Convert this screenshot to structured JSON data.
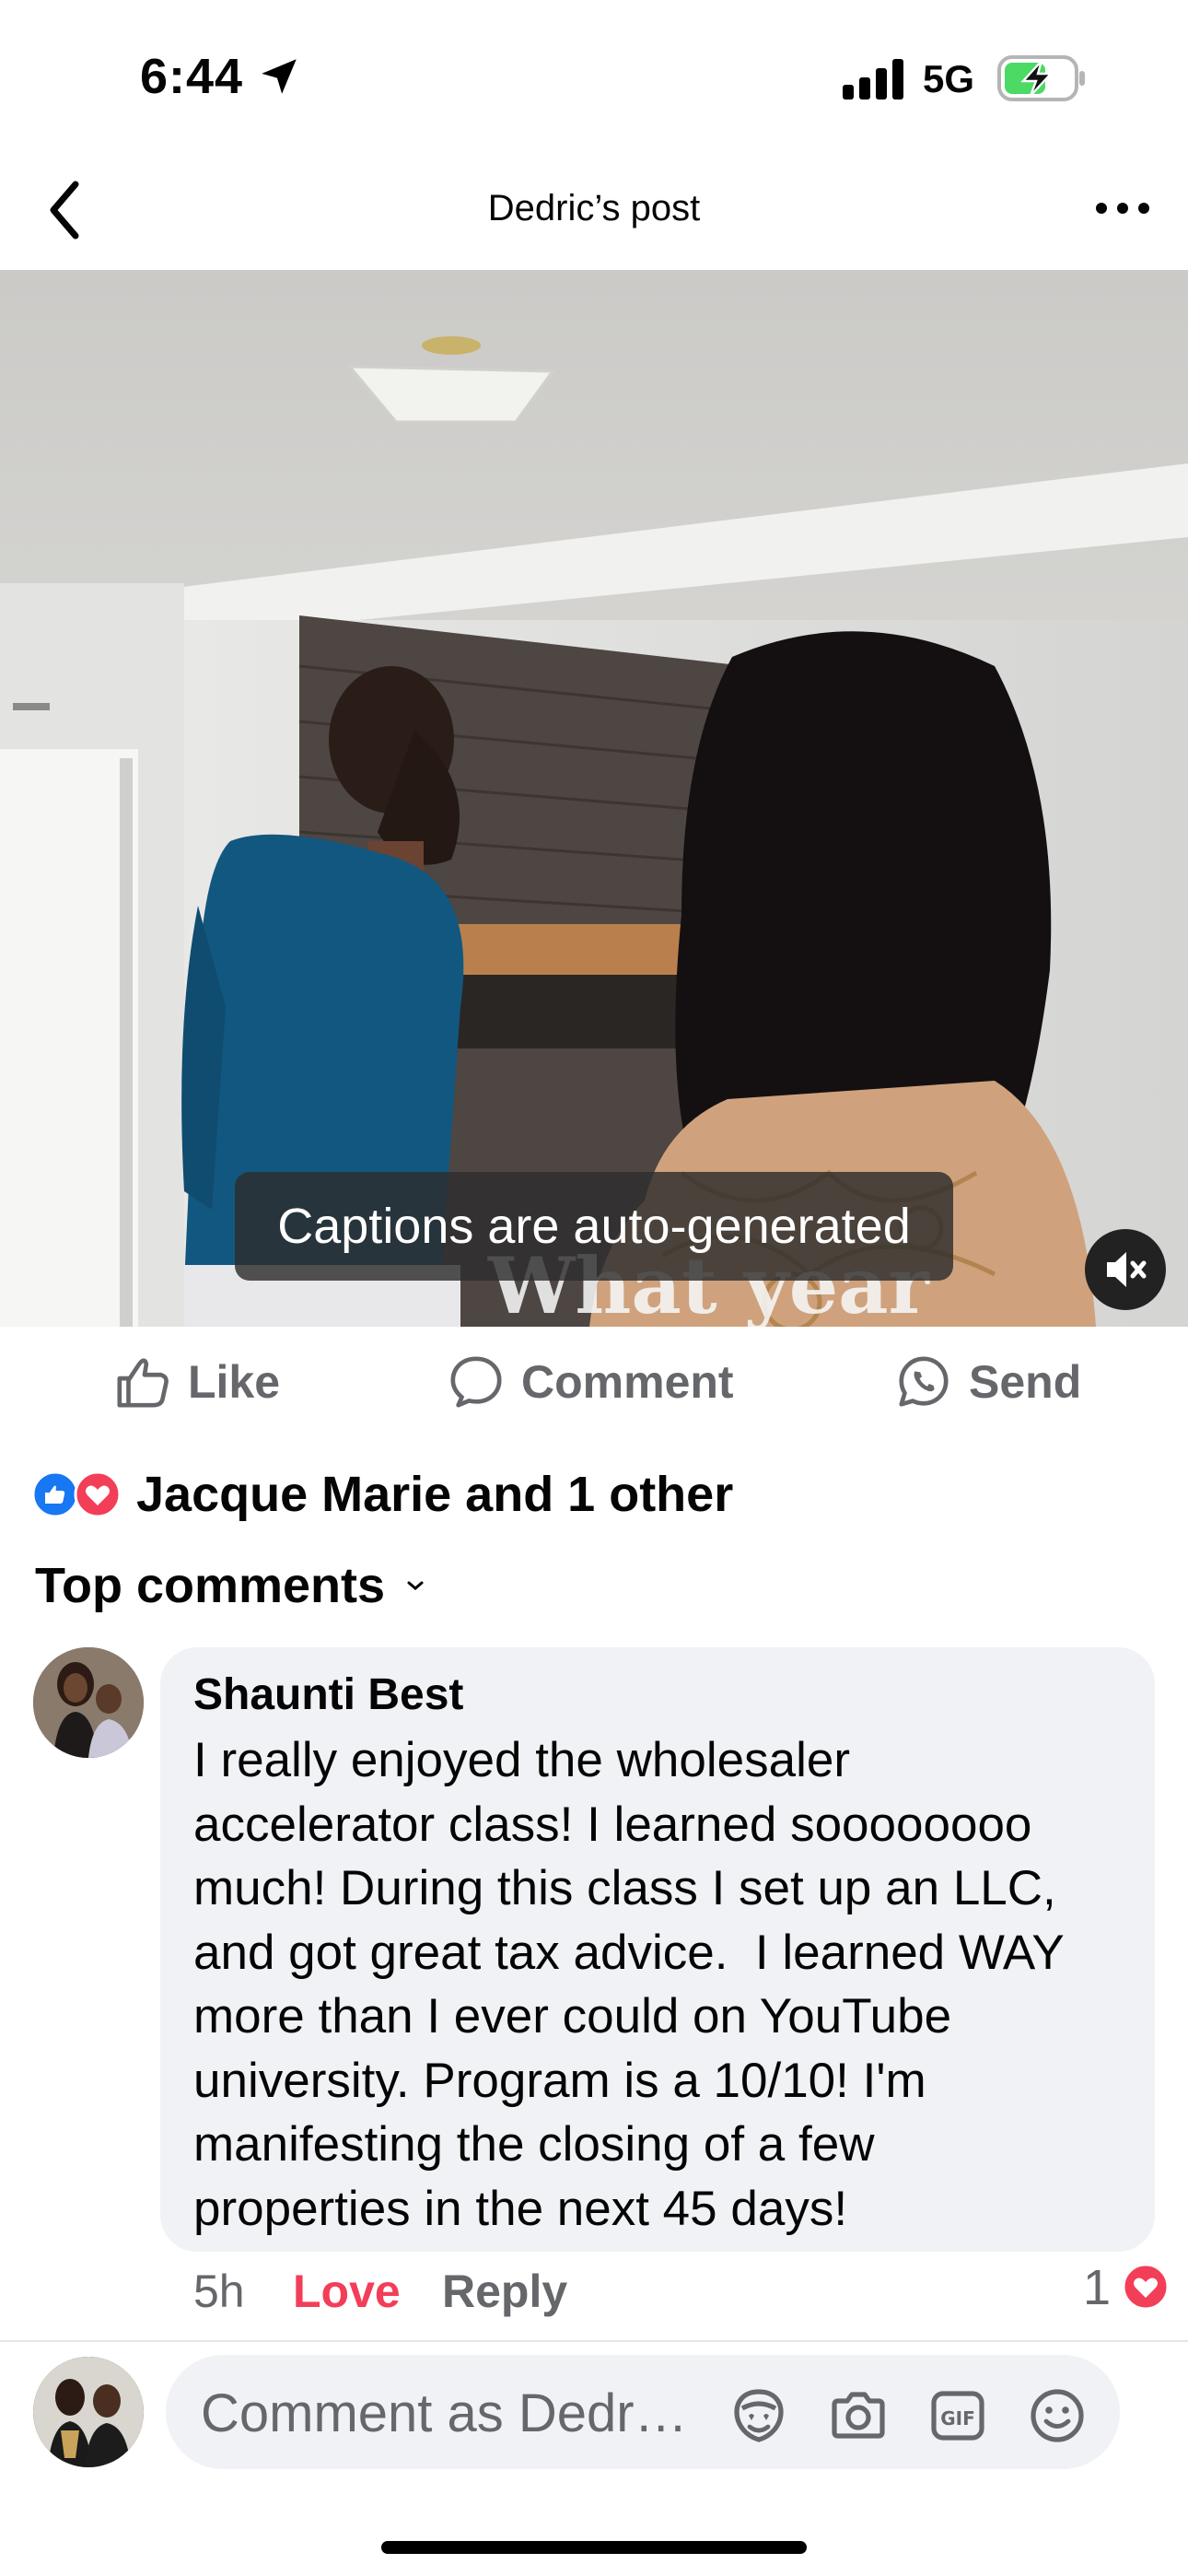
{
  "status_bar": {
    "time": "6:44",
    "network": "5G"
  },
  "header": {
    "title": "Dedric’s post"
  },
  "video": {
    "caption_notice": "Captions are auto-generated",
    "burned_caption": "What year"
  },
  "actions": {
    "like": "Like",
    "comment": "Comment",
    "send": "Send"
  },
  "reactions": {
    "summary": "Jacque Marie and 1 other"
  },
  "comments_section": {
    "sort_label": "Top comments"
  },
  "comment": {
    "author": "Shaunti Best",
    "lines": [
      "I really enjoyed the wholesaler",
      "accelerator class! I learned soooooooo",
      "much! During this class I set up an LLC,",
      "and got great tax advice.  I learned WAY",
      "more than I ever could on YouTube",
      "university. Program is a 10/10! I'm",
      "manifesting the closing of a few",
      "properties in the next 45 days!"
    ],
    "time": "5h",
    "love_label": "Love",
    "reply_label": "Reply",
    "reaction_count": "1"
  },
  "composer": {
    "placeholder": "Comment as Dedr…"
  },
  "colors": {
    "like_blue": "#1877f2",
    "love_red": "#f33e58",
    "battery_green": "#4cd964",
    "muted_text": "#65676b"
  },
  "icons": [
    "location-arrow-icon",
    "signal-icon",
    "battery-charging-icon",
    "back-chevron-icon",
    "more-icon",
    "mute-icon",
    "like-icon",
    "comment-icon",
    "whatsapp-icon",
    "heart-icon",
    "chevron-down-icon",
    "avatar-sticker-icon",
    "camera-icon",
    "gif-icon",
    "emoji-icon"
  ]
}
